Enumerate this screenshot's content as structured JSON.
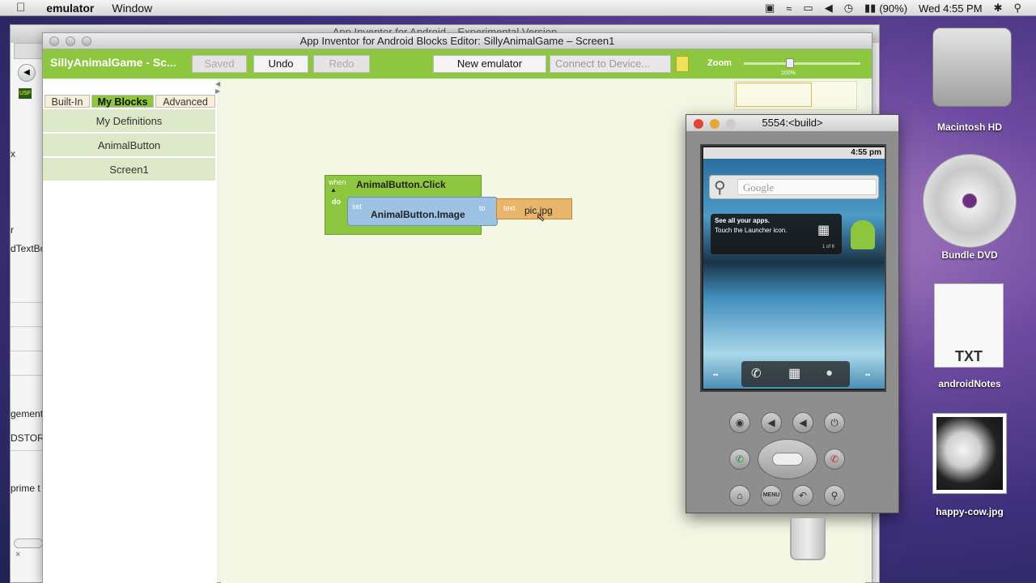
{
  "menubar": {
    "app_name": "emulator",
    "menu_window": "Window",
    "battery": "(90%)",
    "clock": "Wed 4:55 PM"
  },
  "browser": {
    "title": "App Inventor for Android – Experimental Version",
    "sidebar_fragments": [
      "x",
      "r",
      "dTextBo",
      "gement",
      "DSTOR",
      "prime t"
    ]
  },
  "editor": {
    "window_title": "App Inventor for Android Blocks Editor: SillyAnimalGame – Screen1",
    "app_title": "SillyAnimalGame - Sc...",
    "buttons": {
      "saved": "Saved",
      "undo": "Undo",
      "redo": "Redo",
      "new_emulator": "New emulator"
    },
    "connect_placeholder": "Connect to Device...",
    "zoom_label": "Zoom",
    "zoom_value": "100%",
    "drawer_tabs": [
      "Built-In",
      "My Blocks",
      "Advanced"
    ],
    "drawer_items": [
      "My Definitions",
      "AnimalButton",
      "Screen1"
    ],
    "blocks": {
      "when_label": "when",
      "event_name": "AnimalButton.Click",
      "do_label": "do",
      "set_label": "set",
      "property": "AnimalButton.Image",
      "to_label": "to",
      "text_label": "text",
      "text_value": "pic.jpg"
    }
  },
  "emulator": {
    "title": "5554:<build>",
    "status_time": "4:55 pm",
    "search_placeholder": "Google",
    "tip_title": "See all your apps.",
    "tip_body": "Touch the Launcher icon.",
    "tip_page": "1 of 6",
    "menu_label": "MENU"
  },
  "desktop": {
    "items": [
      "Macintosh HD",
      "Bundle DVD",
      "androidNotes",
      "happy-cow.jpg"
    ],
    "txt_badge": "TXT"
  }
}
